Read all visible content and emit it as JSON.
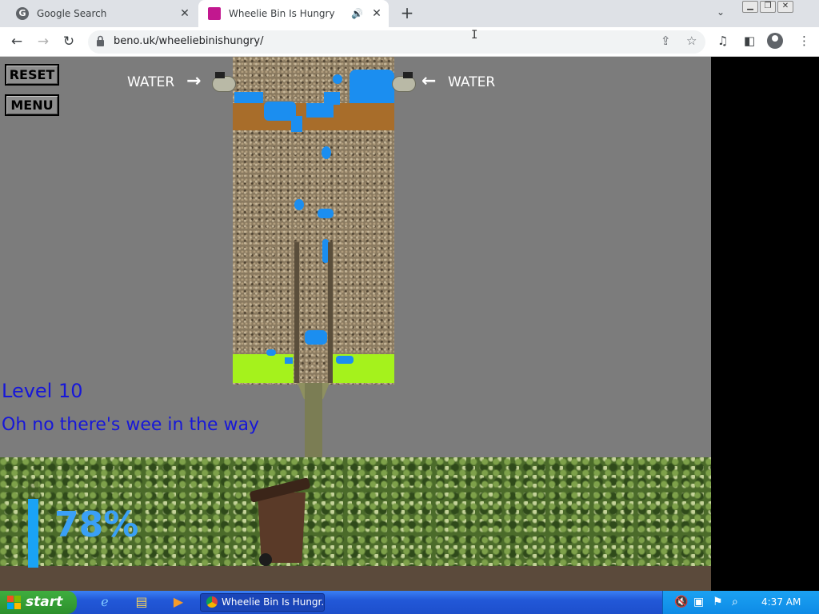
{
  "browser": {
    "tabs": [
      {
        "title": "Google Search",
        "active": false
      },
      {
        "title": "Wheelie Bin Is Hungry",
        "active": true,
        "audio": true
      }
    ],
    "url": "beno.uk/wheeliebinishungry/"
  },
  "game": {
    "buttons": {
      "reset": "RESET",
      "menu": "MENU"
    },
    "water_left": "WATER",
    "water_right": "WATER",
    "level": "Level 10",
    "hint": "Oh no there's wee in the way",
    "progress_text": "78%",
    "progress": 0.78
  },
  "taskbar": {
    "start": "start",
    "window_title": "Wheelie Bin Is Hungr...",
    "clock": "4:37 AM"
  },
  "colors": {
    "water": "#1b8ef0",
    "level_text": "#1717d8",
    "grass_block": "#a5f21c",
    "dirt": "#a86d2a",
    "progress": "#1aa3f5"
  }
}
